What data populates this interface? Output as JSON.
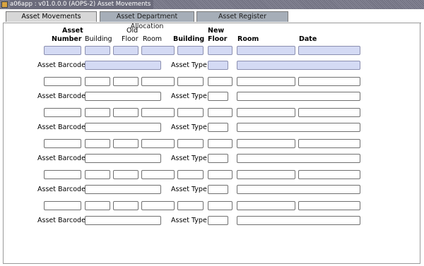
{
  "window": {
    "title": "a06app : v01.0.0.0 (AOPS-2) Asset Movements",
    "icon": "app-icon"
  },
  "tabs": [
    {
      "label": "Asset Movements",
      "active": true
    },
    {
      "label": "Asset Department Allocation",
      "active": false
    },
    {
      "label": "Asset Register",
      "active": false
    }
  ],
  "headers": {
    "asset": "Asset",
    "number": "Number",
    "building_old": "Building",
    "old": "Old",
    "floor_old": "Floor",
    "room_old": "Room",
    "building_new": "Building",
    "new": "New",
    "floor_new": "Floor",
    "room_new": "Room",
    "date": "Date"
  },
  "labels": {
    "asset_barcode": "Asset Barcode",
    "asset_type": "Asset Type"
  },
  "records": [
    {
      "asset_number": "",
      "building_old": "",
      "floor_old": "",
      "room_old": "",
      "building_new": "",
      "floor_new": "",
      "room_new": "",
      "date": "",
      "asset_barcode": "",
      "asset_type": "",
      "asset_type_desc": "",
      "selected": true
    },
    {
      "asset_number": "",
      "building_old": "",
      "floor_old": "",
      "room_old": "",
      "building_new": "",
      "floor_new": "",
      "room_new": "",
      "date": "",
      "asset_barcode": "",
      "asset_type": "",
      "asset_type_desc": "",
      "selected": false
    },
    {
      "asset_number": "",
      "building_old": "",
      "floor_old": "",
      "room_old": "",
      "building_new": "",
      "floor_new": "",
      "room_new": "",
      "date": "",
      "asset_barcode": "",
      "asset_type": "",
      "asset_type_desc": "",
      "selected": false
    },
    {
      "asset_number": "",
      "building_old": "",
      "floor_old": "",
      "room_old": "",
      "building_new": "",
      "floor_new": "",
      "room_new": "",
      "date": "",
      "asset_barcode": "",
      "asset_type": "",
      "asset_type_desc": "",
      "selected": false
    },
    {
      "asset_number": "",
      "building_old": "",
      "floor_old": "",
      "room_old": "",
      "building_new": "",
      "floor_new": "",
      "room_new": "",
      "date": "",
      "asset_barcode": "",
      "asset_type": "",
      "asset_type_desc": "",
      "selected": false
    },
    {
      "asset_number": "",
      "building_old": "",
      "floor_old": "",
      "room_old": "",
      "building_new": "",
      "floor_new": "",
      "room_new": "",
      "date": "",
      "asset_barcode": "",
      "asset_type": "",
      "asset_type_desc": "",
      "selected": false
    }
  ],
  "colors": {
    "selected_field": "#d4daf4",
    "active_tab": "#d7d7d7",
    "inactive_tab": "#a6aeb8"
  }
}
